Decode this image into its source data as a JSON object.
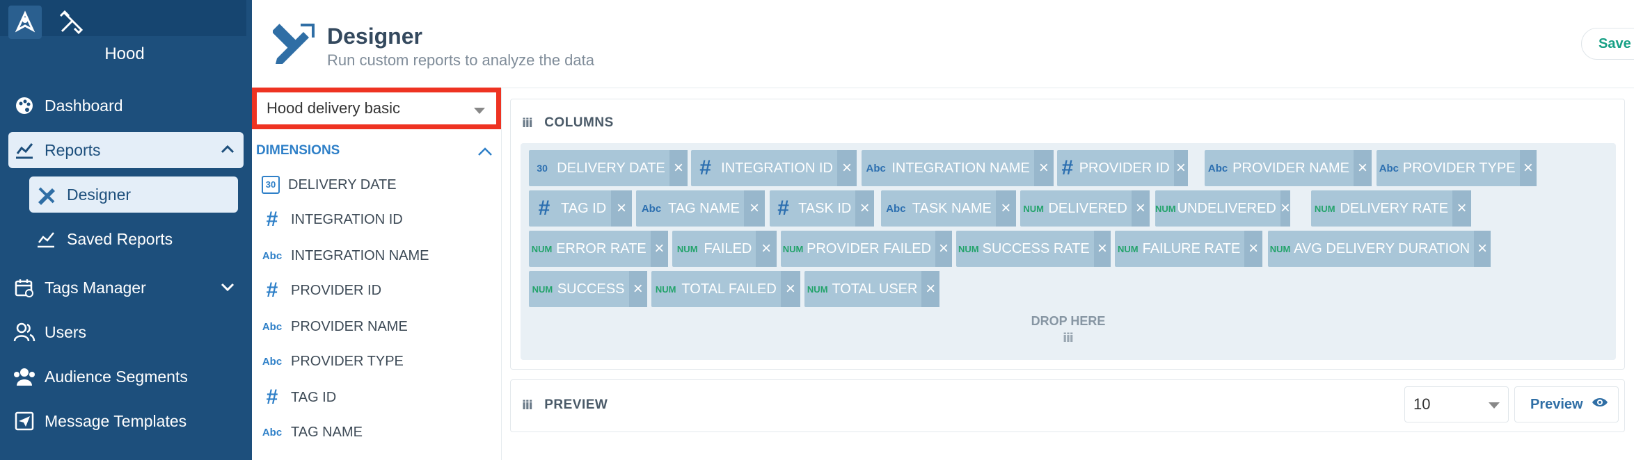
{
  "sidebar": {
    "org_name": "Hood",
    "items": [
      {
        "label": "Dashboard",
        "icon": "palette-icon"
      },
      {
        "label": "Reports",
        "icon": "chart-line-icon"
      },
      {
        "label": "Tags Manager",
        "icon": "calendar-gear-icon"
      },
      {
        "label": "Users",
        "icon": "users-icon"
      },
      {
        "label": "Audience Segments",
        "icon": "audience-icon"
      },
      {
        "label": "Message Templates",
        "icon": "send-icon"
      }
    ],
    "sub_items": [
      {
        "label": "Designer",
        "icon": "designer-icon"
      },
      {
        "label": "Saved Reports",
        "icon": "chart-line-icon"
      }
    ]
  },
  "header": {
    "title": "Designer",
    "subtitle": "Run custom reports to analyze the data",
    "save_label": "Save"
  },
  "report_select": {
    "value": "Hood delivery basic"
  },
  "dimensions": {
    "heading": "DIMENSIONS",
    "items": [
      {
        "type": "date",
        "type_label": "30",
        "label": "DELIVERY DATE"
      },
      {
        "type": "hash",
        "type_label": "#",
        "label": "INTEGRATION ID"
      },
      {
        "type": "abc",
        "type_label": "Abc",
        "label": "INTEGRATION NAME"
      },
      {
        "type": "hash",
        "type_label": "#",
        "label": "PROVIDER ID"
      },
      {
        "type": "abc",
        "type_label": "Abc",
        "label": "PROVIDER NAME"
      },
      {
        "type": "abc",
        "type_label": "Abc",
        "label": "PROVIDER TYPE"
      },
      {
        "type": "hash",
        "type_label": "#",
        "label": "TAG ID"
      },
      {
        "type": "abc",
        "type_label": "Abc",
        "label": "TAG NAME"
      }
    ]
  },
  "columns": {
    "heading": "COLUMNS",
    "drop_here": "DROP HERE",
    "chips": [
      {
        "type_label": "30",
        "label": "DELIVERY DATE"
      },
      {
        "type_label": "#",
        "label": "INTEGRATION ID"
      },
      {
        "type_label": "Abc",
        "label": "INTEGRATION NAME"
      },
      {
        "type_label": "#",
        "label": "PROVIDER ID"
      },
      {
        "type_label": "Abc",
        "label": "PROVIDER NAME"
      },
      {
        "type_label": "Abc",
        "label": "PROVIDER TYPE"
      },
      {
        "type_label": "#",
        "label": "TAG ID"
      },
      {
        "type_label": "Abc",
        "label": "TAG NAME"
      },
      {
        "type_label": "#",
        "label": "TASK ID"
      },
      {
        "type_label": "Abc",
        "label": "TASK NAME"
      },
      {
        "type_label": "NUM",
        "label": "DELIVERED"
      },
      {
        "type_label": "NUM",
        "label": "UNDELIVERED"
      },
      {
        "type_label": "NUM",
        "label": "DELIVERY RATE"
      },
      {
        "type_label": "NUM",
        "label": "ERROR RATE"
      },
      {
        "type_label": "NUM",
        "label": "FAILED"
      },
      {
        "type_label": "NUM",
        "label": "PROVIDER FAILED"
      },
      {
        "type_label": "NUM",
        "label": "SUCCESS RATE"
      },
      {
        "type_label": "NUM",
        "label": "FAILURE RATE"
      },
      {
        "type_label": "NUM",
        "label": "AVG DELIVERY DURATION"
      },
      {
        "type_label": "NUM",
        "label": "SUCCESS"
      },
      {
        "type_label": "NUM",
        "label": "TOTAL FAILED"
      },
      {
        "type_label": "NUM",
        "label": "TOTAL USER"
      }
    ]
  },
  "preview": {
    "heading": "PREVIEW",
    "page_size": "10",
    "button_label": "Preview"
  }
}
